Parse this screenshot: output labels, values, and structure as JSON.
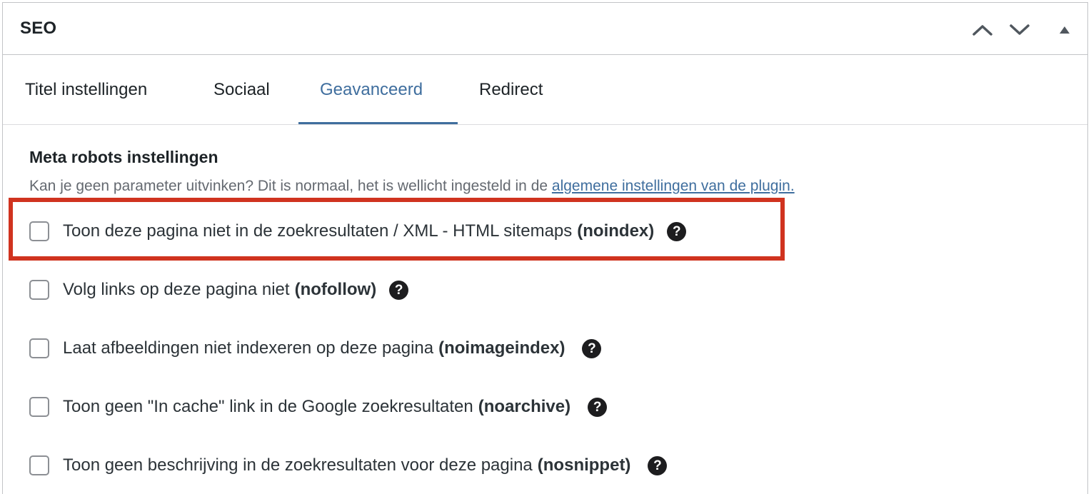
{
  "panel": {
    "title": "SEO",
    "controls": {
      "move_up": "chevron-up-icon",
      "move_down": "chevron-down-icon",
      "toggle": "triangle-up-icon"
    }
  },
  "tabs": [
    {
      "label": "Titel instellingen",
      "active": false
    },
    {
      "label": "Sociaal",
      "active": false
    },
    {
      "label": "Geavanceerd",
      "active": true
    },
    {
      "label": "Redirect",
      "active": false
    }
  ],
  "section": {
    "title": "Meta robots instellingen",
    "description": "Kan je geen parameter uitvinken? Dit is normaal, het is wellicht ingesteld in de ",
    "link_text": "algemene instellingen van de plugin."
  },
  "options": [
    {
      "label": "Toon deze pagina niet in de zoekresultaten / XML - HTML sitemaps",
      "code": "(noindex)",
      "checked": false,
      "help": "?"
    },
    {
      "label": "Volg links op deze pagina niet",
      "code": "(nofollow)",
      "checked": false,
      "help": "?"
    },
    {
      "label": "Laat afbeeldingen niet indexeren op deze pagina",
      "code": "(noimageindex)",
      "checked": false,
      "help": "?"
    },
    {
      "label": "Toon geen \"In cache\" link in de Google zoekresultaten",
      "code": "(noarchive)",
      "checked": false,
      "help": "?"
    },
    {
      "label": "Toon geen beschrijving in de zoekresultaten voor deze pagina",
      "code": "(nosnippet)",
      "checked": false,
      "help": "?"
    }
  ],
  "colors": {
    "accent": "#3f6e9e",
    "highlight": "#d0331f",
    "border": "#c3c4c7",
    "help_bg": "#1d1d1f"
  }
}
